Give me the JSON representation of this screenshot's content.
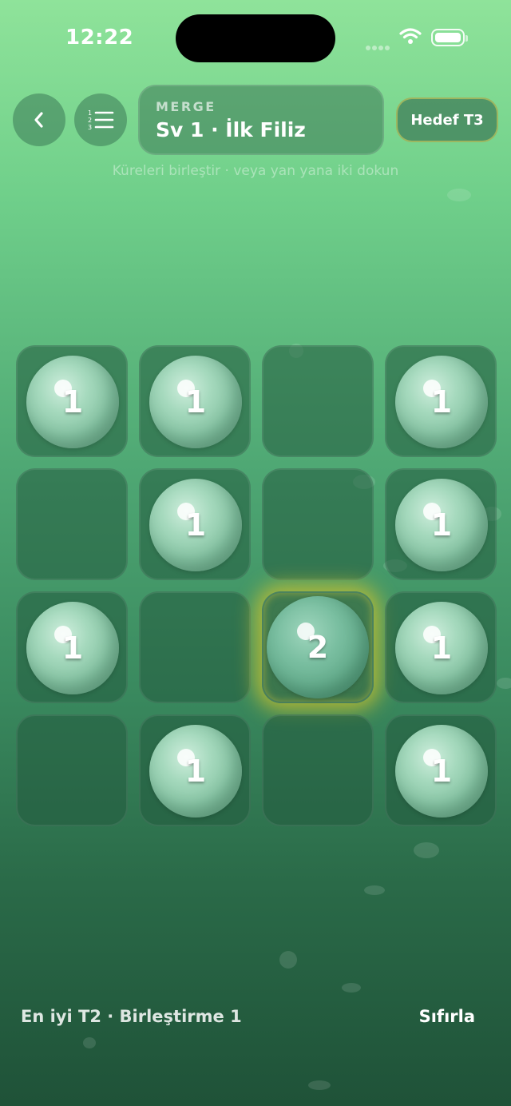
{
  "status": {
    "time": "12:22"
  },
  "header": {
    "mode_label": "MERGE",
    "level_title": "Sv 1 · İlk Filiz",
    "target_label": "Hedef T3",
    "back_icon": "chevron-left-icon",
    "levels_icon": "numbered-list-icon"
  },
  "hint": "Küreleri birleştir · veya yan yana iki dokun",
  "board": {
    "rows": [
      [
        "1",
        "1",
        "",
        "1"
      ],
      [
        "",
        "1",
        "",
        "1"
      ],
      [
        "1",
        "",
        "2",
        "1"
      ],
      [
        "",
        "1",
        "",
        "1"
      ]
    ],
    "selected": {
      "row": 2,
      "col": 2
    }
  },
  "footer": {
    "stats": "En iyi T2 · Birleştirme 1",
    "reset_label": "Sıfırla"
  },
  "colors": {
    "accent_glow": "#dcc828",
    "bg_top": "#8fe39a",
    "bg_bottom": "#1f5238"
  }
}
